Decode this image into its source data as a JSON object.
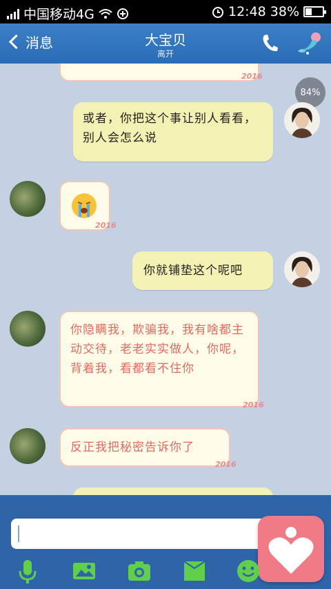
{
  "status_bar": {
    "carrier": "中国移动4G",
    "time": "12:48",
    "battery": "38%",
    "battery_level": 0.38
  },
  "header": {
    "back_label": "消息",
    "title": "大宝贝",
    "subtitle": "离开"
  },
  "float_badge": {
    "percent": "84%"
  },
  "messages": [
    {
      "from": "me",
      "text": "或者，你把这个事让别人看看，别人会怎么说"
    },
    {
      "from": "them",
      "sticker": "crying-face"
    },
    {
      "from": "me",
      "text": "你就铺垫这个呢吧"
    },
    {
      "from": "them",
      "text": "你隐瞒我，欺骗我，我有啥都主动交待，老老实实做人，你呢，背着我，看都看不住你"
    },
    {
      "from": "them",
      "text": "反正我把秘密告诉你了"
    }
  ],
  "bubble_decoration": "2016",
  "input": {
    "placeholder": ""
  },
  "toolbar_icons": [
    "mic-icon",
    "image-icon",
    "camera-icon",
    "folder-icon",
    "emoji-icon"
  ],
  "colors": {
    "header_bg": "#2b6db5",
    "chat_bg": "#c3d1e2",
    "my_bubble": "#f4f1b4",
    "their_bubble_text": "#e06a5f",
    "toolbar_icon": "#5fcf4c",
    "heart_button": "#f17a87"
  }
}
